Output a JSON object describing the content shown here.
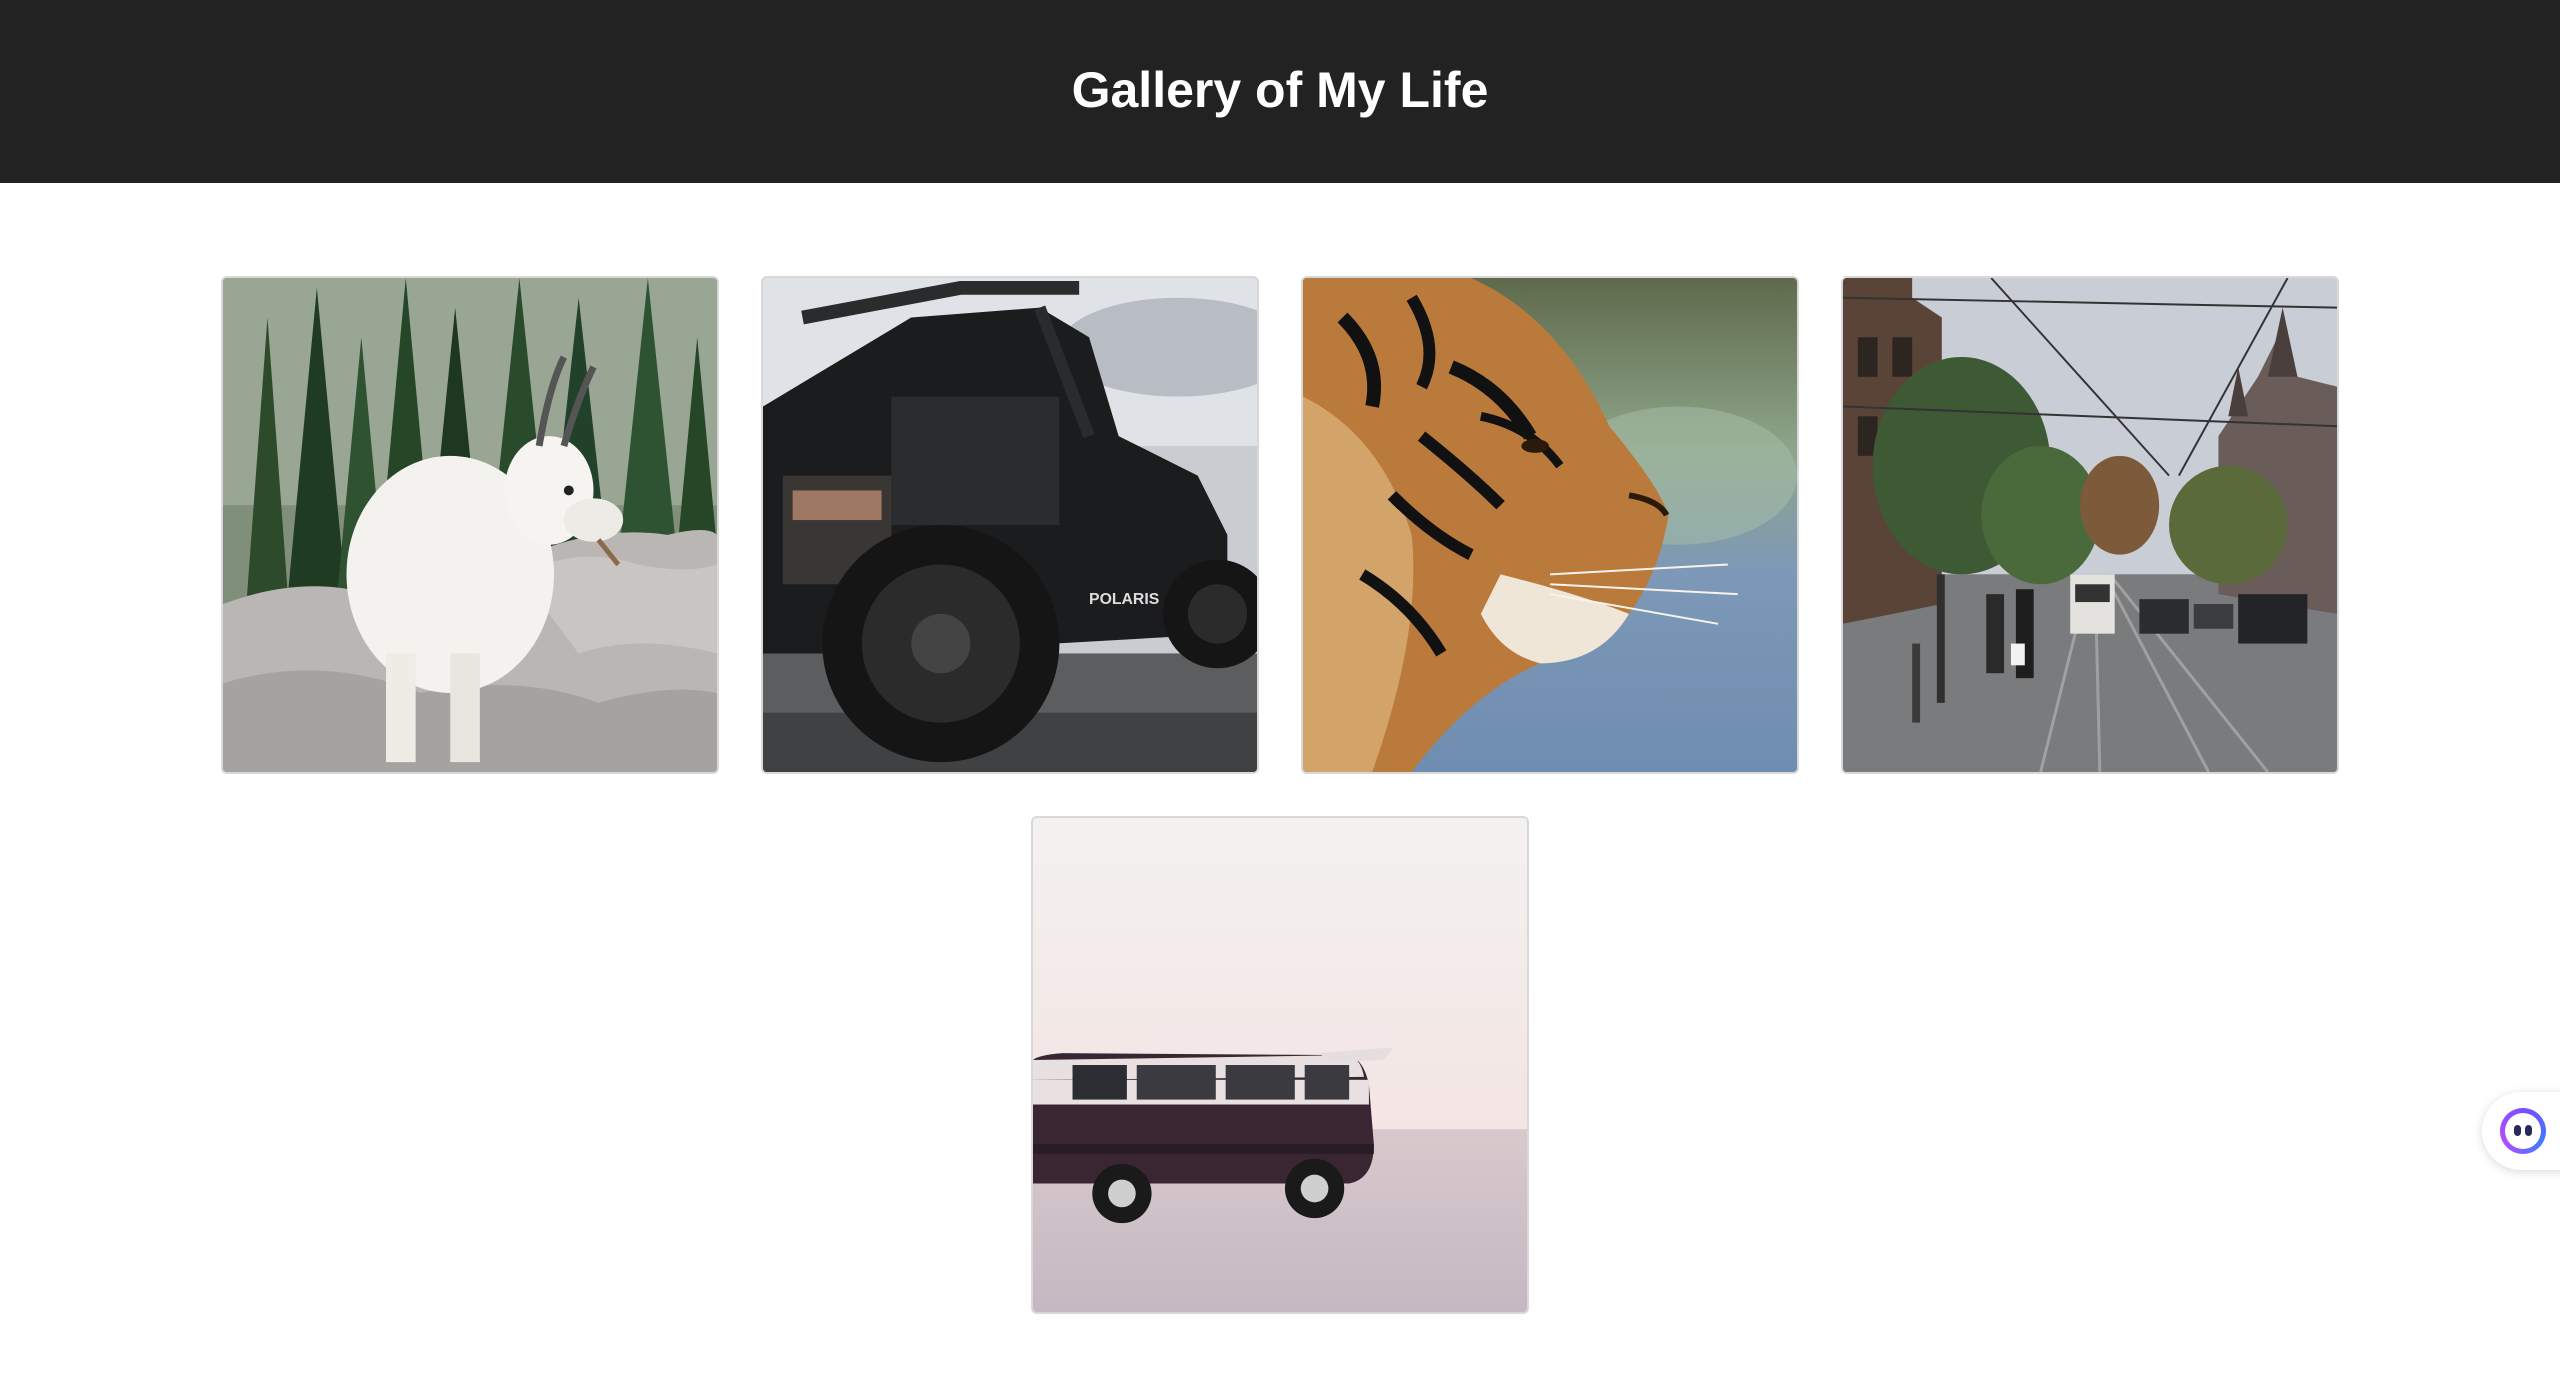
{
  "header": {
    "title": "Gallery of My Life"
  },
  "gallery": {
    "images": [
      {
        "subject": "mountain goat on rocks"
      },
      {
        "subject": "off-road utility vehicle"
      },
      {
        "subject": "tiger profile"
      },
      {
        "subject": "city street with tram"
      },
      {
        "subject": "van on beach at sunset"
      }
    ]
  },
  "assistant_widget": {
    "icon": "assistant-face-icon"
  }
}
